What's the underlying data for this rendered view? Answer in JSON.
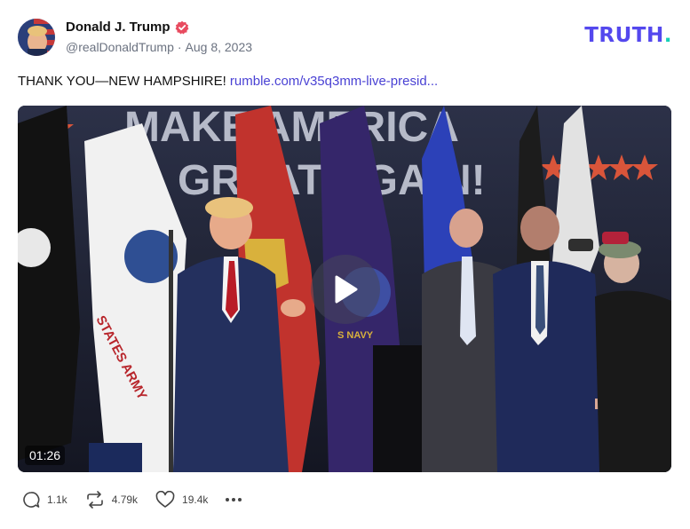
{
  "author": {
    "display_name": "Donald J. Trump",
    "handle": "@realDonaldTrump",
    "separator": "·",
    "date": "Aug 8, 2023",
    "verified_color": "#e84b5f"
  },
  "brand": {
    "logo_text": "TRUTH",
    "logo_dot": ".",
    "logo_color": "#5448ee",
    "dot_color": "#17d0b7"
  },
  "post": {
    "text": "THANK YOU—NEW HAMPSHIRE!",
    "link_text": "rumble.com/v35q3mm-live-presid...",
    "link_color": "#4a42d4"
  },
  "video": {
    "duration": "01:26",
    "banner_line1": "MAKE AMERICA",
    "banner_line2": "GREAT AGAIN!",
    "flag_text_army": "STATES ARMY",
    "flag_text_navy": "S NAVY",
    "play_icon": "play-icon"
  },
  "actions": {
    "replies": "1.1k",
    "retruths": "4.79k",
    "likes": "19.4k",
    "reply_icon": "comment-icon",
    "retruth_icon": "retruth-icon",
    "like_icon": "heart-icon",
    "more_icon": "more-dots-icon"
  }
}
